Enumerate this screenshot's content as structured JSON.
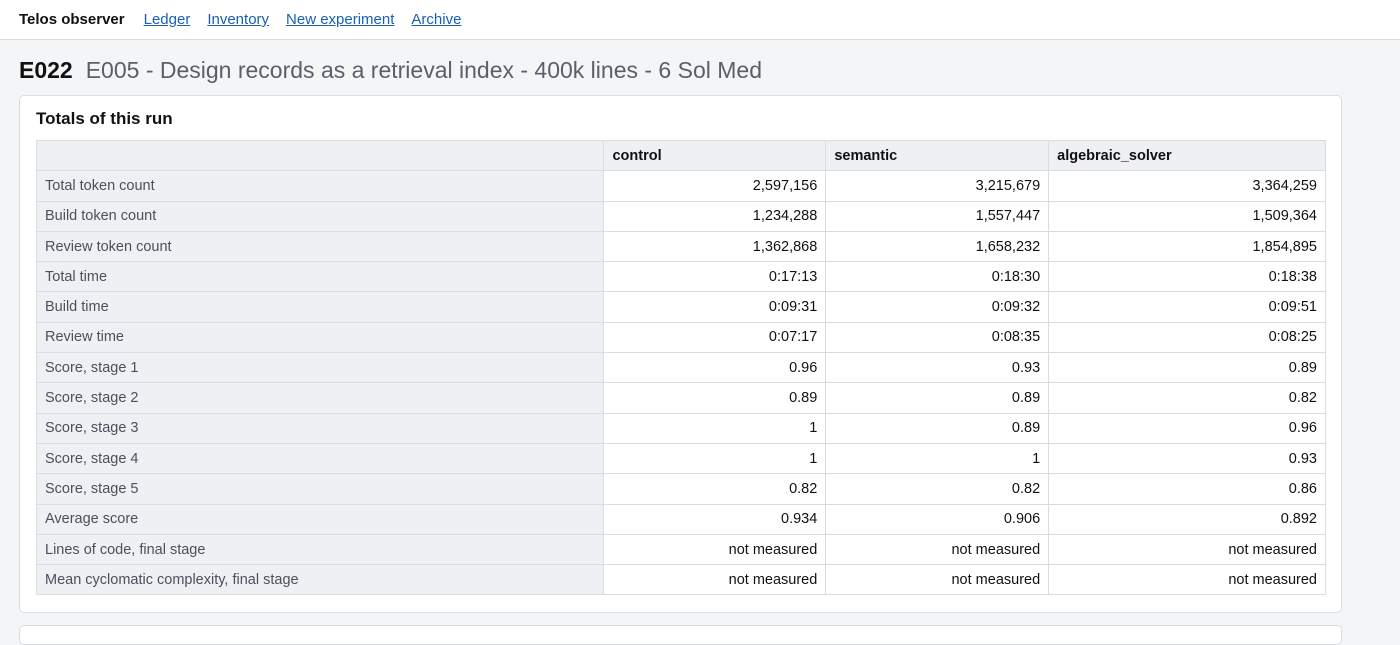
{
  "nav": {
    "brand": "Telos observer",
    "links": [
      "Ledger",
      "Inventory",
      "New experiment",
      "Archive"
    ]
  },
  "experiment": {
    "id": "E022",
    "title": "E005 - Design records as a retrieval index - 400k lines - 6 Sol Med"
  },
  "totals": {
    "title": "Totals of this run",
    "columns": [
      "",
      "control",
      "semantic",
      "algebraic_solver"
    ],
    "rows": [
      {
        "label": "Total token count",
        "values": [
          "2,597,156",
          "3,215,679",
          "3,364,259"
        ]
      },
      {
        "label": "Build token count",
        "values": [
          "1,234,288",
          "1,557,447",
          "1,509,364"
        ]
      },
      {
        "label": "Review token count",
        "values": [
          "1,362,868",
          "1,658,232",
          "1,854,895"
        ]
      },
      {
        "label": "Total time",
        "values": [
          "0:17:13",
          "0:18:30",
          "0:18:38"
        ]
      },
      {
        "label": "Build time",
        "values": [
          "0:09:31",
          "0:09:32",
          "0:09:51"
        ]
      },
      {
        "label": "Review time",
        "values": [
          "0:07:17",
          "0:08:35",
          "0:08:25"
        ]
      },
      {
        "label": "Score, stage 1",
        "values": [
          "0.96",
          "0.93",
          "0.89"
        ]
      },
      {
        "label": "Score, stage 2",
        "values": [
          "0.89",
          "0.89",
          "0.82"
        ]
      },
      {
        "label": "Score, stage 3",
        "values": [
          "1",
          "0.89",
          "0.96"
        ]
      },
      {
        "label": "Score, stage 4",
        "values": [
          "1",
          "1",
          "0.93"
        ]
      },
      {
        "label": "Score, stage 5",
        "values": [
          "0.82",
          "0.82",
          "0.86"
        ]
      },
      {
        "label": "Average score",
        "values": [
          "0.934",
          "0.906",
          "0.892"
        ]
      },
      {
        "label": "Lines of code, final stage",
        "values": [
          "not measured",
          "not measured",
          "not measured"
        ]
      },
      {
        "label": "Mean cyclomatic complexity, final stage",
        "values": [
          "not measured",
          "not measured",
          "not measured"
        ]
      }
    ]
  }
}
